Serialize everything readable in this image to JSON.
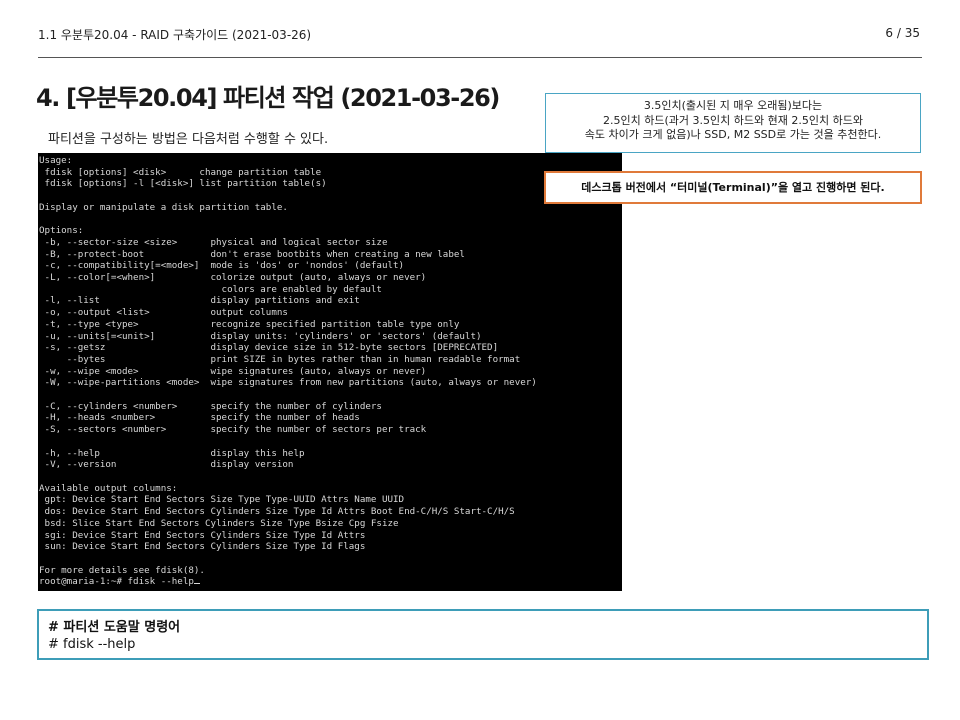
{
  "header": {
    "doc_title": "1.1 우분투20.04 - RAID 구축가이드 (2021-03-26)",
    "page": "6 / 35"
  },
  "slide": {
    "title": "4. [우분투20.04] 파티션 작업 (2021-03-26)",
    "intro": "파티션을 구성하는 방법은 다음처럼 수행할 수 있다."
  },
  "info_box": {
    "lines": [
      "3.5인치(출시된 지 매우 오래됨)보다는",
      "2.5인치 하드(과거 3.5인치 하드와 현재 2.5인치 하드와",
      "속도 차이가 크게 없음)나 SSD, M2 SSD로 가는 것을 추천한다."
    ]
  },
  "warn_box": {
    "text": "데스크톱 버전에서 “터미널(Terminal)”을 열고 진행하면 된다."
  },
  "terminal": {
    "lines": [
      "Usage:",
      " fdisk [options] <disk>      change partition table",
      " fdisk [options] -l [<disk>] list partition table(s)",
      "",
      "Display or manipulate a disk partition table.",
      "",
      "Options:",
      " -b, --sector-size <size>      physical and logical sector size",
      " -B, --protect-boot            don't erase bootbits when creating a new label",
      " -c, --compatibility[=<mode>]  mode is 'dos' or 'nondos' (default)",
      " -L, --color[=<when>]          colorize output (auto, always or never)",
      "                                 colors are enabled by default",
      " -l, --list                    display partitions and exit",
      " -o, --output <list>           output columns",
      " -t, --type <type>             recognize specified partition table type only",
      " -u, --units[=<unit>]          display units: 'cylinders' or 'sectors' (default)",
      " -s, --getsz                   display device size in 512-byte sectors [DEPRECATED]",
      "     --bytes                   print SIZE in bytes rather than in human readable format",
      " -w, --wipe <mode>             wipe signatures (auto, always or never)",
      " -W, --wipe-partitions <mode>  wipe signatures from new partitions (auto, always or never)",
      "",
      " -C, --cylinders <number>      specify the number of cylinders",
      " -H, --heads <number>          specify the number of heads",
      " -S, --sectors <number>        specify the number of sectors per track",
      "",
      " -h, --help                    display this help",
      " -V, --version                 display version",
      "",
      "Available output columns:",
      " gpt: Device Start End Sectors Size Type Type-UUID Attrs Name UUID",
      " dos: Device Start End Sectors Cylinders Size Type Id Attrs Boot End-C/H/S Start-C/H/S",
      " bsd: Slice Start End Sectors Cylinders Size Type Bsize Cpg Fsize",
      " sgi: Device Start End Sectors Cylinders Size Type Id Attrs",
      " sun: Device Start End Sectors Cylinders Size Type Id Flags",
      "",
      "For more details see fdisk(8).",
      "root@maria-1:~# fdisk --help"
    ]
  },
  "command_box": {
    "title": "# 파티션 도움말 명령어",
    "command": "# fdisk --help"
  }
}
